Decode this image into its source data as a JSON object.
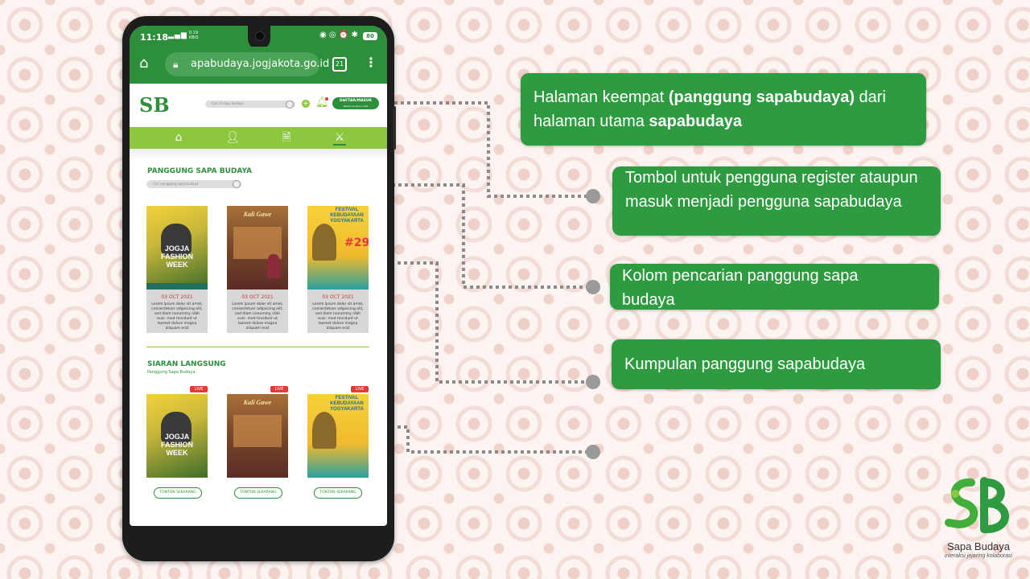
{
  "phone": {
    "status_time": "11:18",
    "status_net": "0.19 KB/S",
    "status_battery": "80",
    "url": "apabudaya.jogjakota.go.id",
    "tab_count": "21"
  },
  "site": {
    "logo_text": "SB",
    "search_placeholder": "Cari di sapa budaya",
    "register_label": "DAFTAR/MASUK",
    "register_sub": "Masuk ke akun anda",
    "section1_title": "PANGGUNG SAPA BUDAYA",
    "section1_search_placeholder": "Cari panggung sapa budaya",
    "section2_title": "SIARAN LANGSUNG",
    "section2_subtitle": "Panggung Sapa Budaya",
    "cards": [
      {
        "poster_title": "JOGJA FASHION WEEK",
        "date": "03 OCT 2021",
        "desc": "Lorem ipsum dolor sit amet, consectetuer adipiscing elit, sed diam nonummy nibh euis- mod tincidunt ut laoreet dolore magna aliquam erat"
      },
      {
        "poster_title": "Kali Gawe",
        "date": "03 OCT 2021",
        "desc": "Lorem ipsum dolor sit amet, consectetuer adipiscing elit, sed diam nonummy nibh euis- mod tincidunt ut laoreet dolore magna aliquam erat"
      },
      {
        "poster_title": "FESTIVAL KEBUDAYAAN YOGYAKARTA",
        "date": "03 OCT 2021",
        "desc": "Lorem ipsum dolor sit amet, consectetuer adipiscing elit, sed diam nonummy nibh euis- mod tincidunt ut laoreet dolore magna aliquam erat"
      }
    ],
    "live_badge": "LIVE",
    "watch_label": "TONTON SEKARANG"
  },
  "callouts": {
    "c1_a": "Halaman keempat ",
    "c1_b": "(panggung sapabudaya)",
    "c1_c": " dari halaman utama ",
    "c1_d": "sapabudaya",
    "c2": "Tombol untuk pengguna register ataupun masuk menjadi pengguna sapabudaya",
    "c3": "Kolom pencarian panggung sapa budaya",
    "c4": "Kumpulan panggung sapabudaya"
  },
  "brand": {
    "name": "Sapa Budaya",
    "tagline": "interaksi jejaring kolaborasi"
  },
  "colors": {
    "green_dark": "#2d8f3b",
    "green_light": "#8dc63f",
    "callout_green": "#2e9b41",
    "connector_gray": "#8a8a8a"
  }
}
